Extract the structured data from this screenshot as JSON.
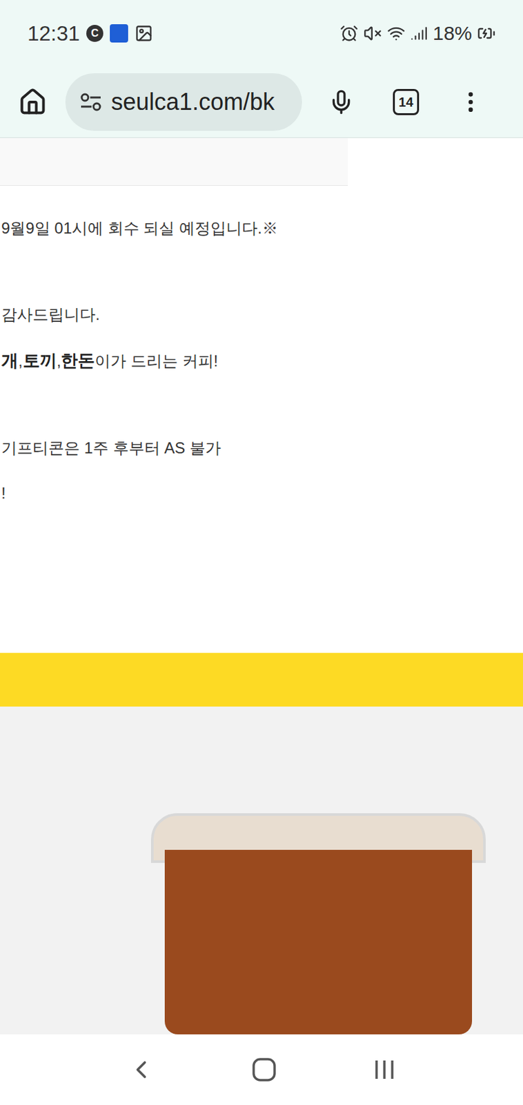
{
  "status_bar": {
    "time": "12:31",
    "c_icon_label": "C",
    "battery": "18%",
    "battery_charging": true
  },
  "browser": {
    "url": "seulca1.com/bk",
    "tab_count": "14"
  },
  "page": {
    "lines": [
      [
        {
          "text": "9월9일 01시에 회수 되실 예정입니다.※",
          "bold": false
        }
      ],
      [
        {
          "text": "감사드립니다.",
          "bold": false
        }
      ],
      [
        {
          "text": "개",
          "bold": true
        },
        {
          "text": ",",
          "bold": false
        },
        {
          "text": "토끼",
          "bold": true
        },
        {
          "text": ",",
          "bold": false
        },
        {
          "text": "한돈",
          "bold": true
        },
        {
          "text": "이가 드리는 커피!",
          "bold": false
        }
      ],
      [
        {
          "text": "기프티콘은 1주 후부터 AS 불가",
          "bold": false
        }
      ],
      [
        {
          "text": "!",
          "bold": false
        }
      ]
    ]
  }
}
